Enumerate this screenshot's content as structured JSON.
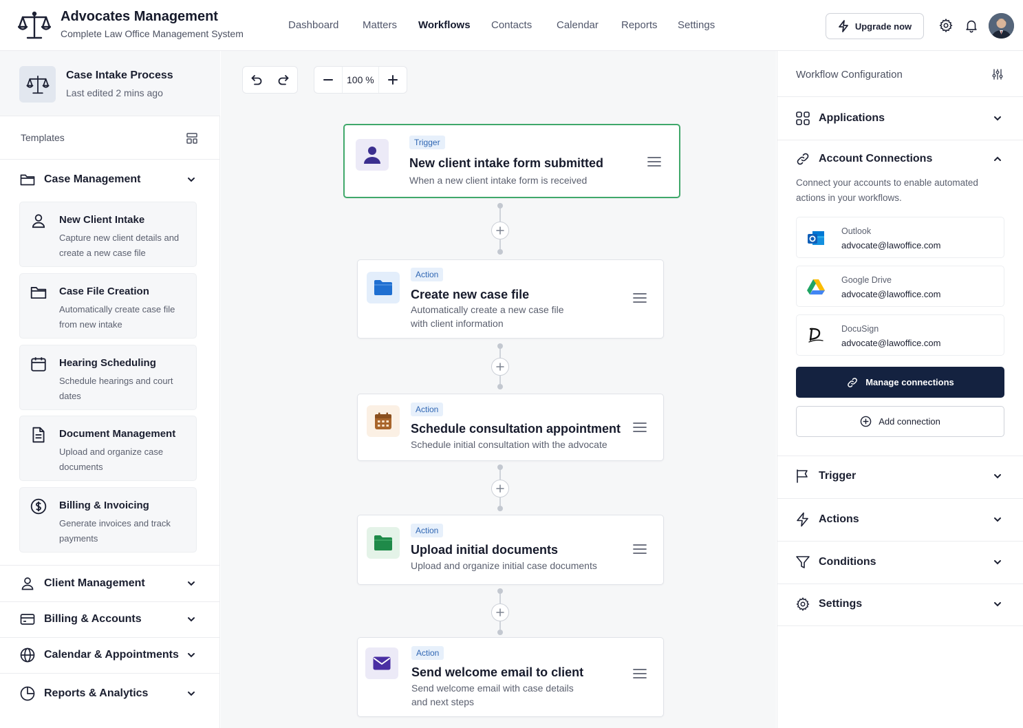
{
  "app": {
    "title": "Advocates Management",
    "subtitle": "Complete Law Office Management System"
  },
  "nav": {
    "items": [
      {
        "label": "Dashboard",
        "active": false
      },
      {
        "label": "Matters",
        "active": false
      },
      {
        "label": "Workflows",
        "active": true
      },
      {
        "label": "Contacts",
        "active": false
      },
      {
        "label": "Calendar",
        "active": false
      },
      {
        "label": "Reports",
        "active": false
      },
      {
        "label": "Settings",
        "active": false
      }
    ],
    "upgrade_label": "Upgrade now",
    "icons": [
      "bolt-icon",
      "gear-icon",
      "bell-icon",
      "avatar"
    ]
  },
  "process": {
    "title": "Case Intake Process",
    "last_edited": "Last edited 2 mins ago"
  },
  "sidebar": {
    "templates_label": "Templates",
    "categories": [
      {
        "label": "Case Management",
        "icon": "folder-icon",
        "expanded": true
      },
      {
        "label": "Client Management",
        "icon": "user-icon",
        "expanded": false
      },
      {
        "label": "Billing & Accounts",
        "icon": "credit-card-icon",
        "expanded": false
      },
      {
        "label": "Calendar & Appointments",
        "icon": "globe-icon",
        "expanded": false
      },
      {
        "label": "Reports & Analytics",
        "icon": "pie-chart-icon",
        "expanded": false
      }
    ],
    "templates": [
      {
        "title": "New Client Intake",
        "desc": "Capture new client details and create a new case file",
        "icon": "user-icon"
      },
      {
        "title": "Case File Creation",
        "desc": "Automatically create case file from new intake",
        "icon": "folder-icon"
      },
      {
        "title": "Hearing Scheduling",
        "desc": "Schedule hearings and court dates",
        "icon": "calendar-icon"
      },
      {
        "title": "Document Management",
        "desc": "Upload and organize case documents",
        "icon": "document-icon"
      },
      {
        "title": "Billing & Invoicing",
        "desc": "Generate invoices and track payments",
        "icon": "dollar-icon"
      }
    ]
  },
  "canvas": {
    "zoom": "100 %",
    "nodes": [
      {
        "badge": "Trigger",
        "title": "New client intake form submitted",
        "desc": "When a new client intake form is received",
        "icon": "user-icon"
      },
      {
        "badge": "Action",
        "title": "Create new case file",
        "desc": "Automatically create a new case file with client information",
        "icon": "folder-icon"
      },
      {
        "badge": "Action",
        "title": "Schedule consultation appointment",
        "desc": "Schedule initial consultation with the advocate",
        "icon": "calendar-icon"
      },
      {
        "badge": "Action",
        "title": "Upload initial documents",
        "desc": "Upload and organize initial case documents",
        "icon": "folder-icon"
      },
      {
        "badge": "Action",
        "title": "Send welcome email to client",
        "desc": "Send welcome email with case details and next steps",
        "icon": "mail-icon"
      }
    ]
  },
  "config": {
    "title": "Workflow Configuration",
    "sections": [
      {
        "label": "Applications",
        "icon": "grid-icon",
        "expanded": false
      },
      {
        "label": "Account Connections",
        "icon": "link-icon",
        "expanded": true
      },
      {
        "label": "Trigger",
        "icon": "flag-icon",
        "expanded": false
      },
      {
        "label": "Actions",
        "icon": "bolt-icon",
        "expanded": false
      },
      {
        "label": "Conditions",
        "icon": "filter-icon",
        "expanded": false
      },
      {
        "label": "Settings",
        "icon": "gear-icon",
        "expanded": false
      }
    ],
    "connections_desc": "Connect your accounts to enable automated actions in your workflows.",
    "accounts": [
      {
        "name": "Outlook",
        "email": "advocate@lawoffice.com",
        "icon": "outlook-logo"
      },
      {
        "name": "Google Drive",
        "email": "advocate@lawoffice.com",
        "icon": "google-drive-logo"
      },
      {
        "name": "DocuSign",
        "email": "advocate@lawoffice.com",
        "icon": "docusign-logo"
      }
    ],
    "manage_label": "Manage connections",
    "add_label": "Add connection"
  },
  "colors": {
    "primary_dark": "#142240",
    "trigger_border": "#3fa86a",
    "badge_bg": "#e7f0fb",
    "badge_text": "#2f66b3"
  }
}
